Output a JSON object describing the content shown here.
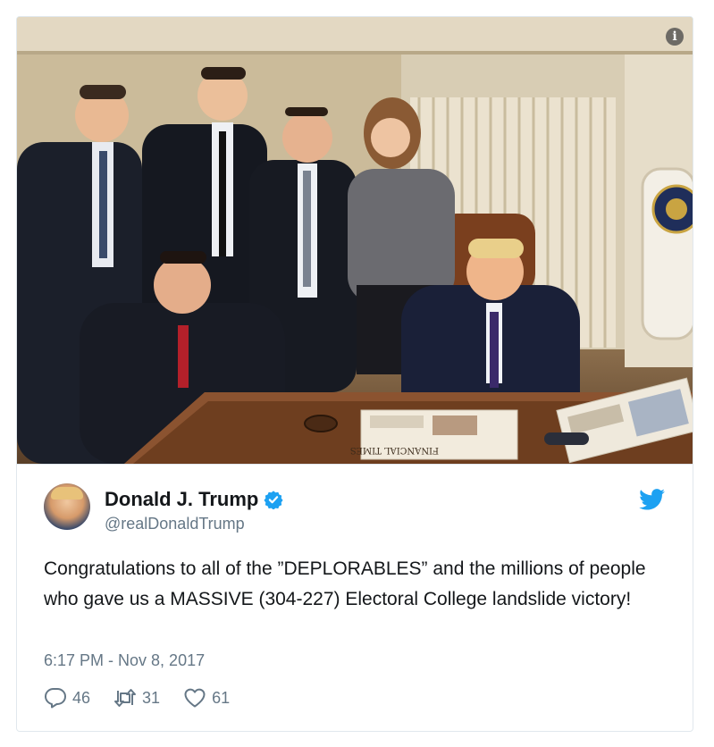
{
  "tweet": {
    "author_name": "Donald J. Trump",
    "handle": "@realDonaldTrump",
    "text": "Congratulations to all of the ”DEPLORABLES” and the millions of people who gave us a MASSIVE (304-227) Electoral College landslide victory!",
    "timestamp": "6:17 PM - Nov 8, 2017",
    "replies": "46",
    "retweets": "31",
    "likes": "61"
  },
  "photo": {
    "info_label": "i",
    "newspaper_text": "FINANCIAL TIMES"
  },
  "icons": {
    "verified": "verified-badge-icon",
    "brand": "twitter-bird-icon",
    "reply": "reply-icon",
    "retweet": "retweet-icon",
    "like": "heart-icon"
  },
  "colors": {
    "brand_blue": "#1da1f2",
    "text_primary": "#14171a",
    "text_secondary": "#657786",
    "border": "#e1e8ed"
  }
}
